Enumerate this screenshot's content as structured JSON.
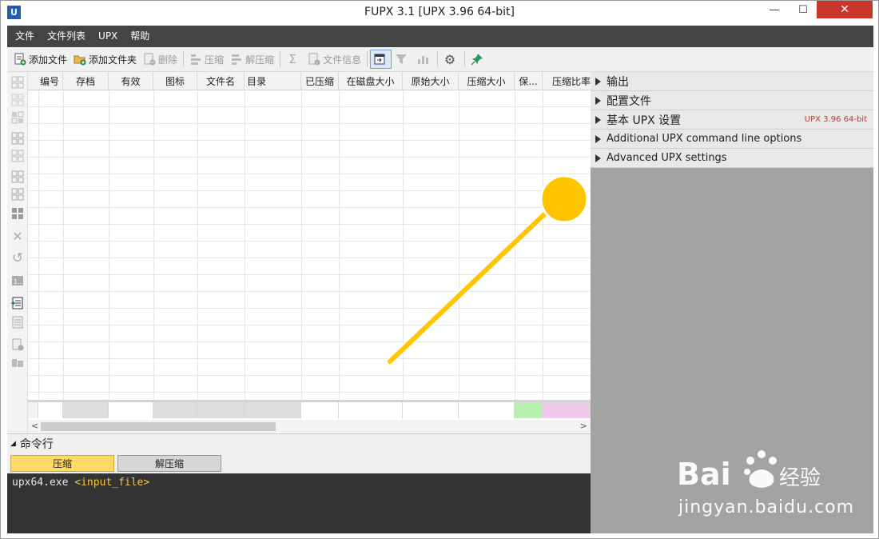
{
  "window": {
    "title": "FUPX 3.1   [UPX 3.96 64-bit]",
    "app_icon": "U",
    "min": "—",
    "max": "☐",
    "close": "✕"
  },
  "menu": [
    "文件",
    "文件列表",
    "UPX",
    "帮助"
  ],
  "toolbar": {
    "add_file": "添加文件",
    "add_folder": "添加文件夹",
    "delete": "删除",
    "compress": "压缩",
    "decompress": "解压缩",
    "file_info": "文件信息"
  },
  "grid": {
    "columns": [
      "编号",
      "存档",
      "有效",
      "图标",
      "文件名",
      "目录",
      "已压缩",
      "在磁盘大小",
      "原始大小",
      "压缩大小",
      "保...",
      "压缩比率"
    ],
    "scroll_left": "<",
    "scroll_right": ">"
  },
  "command": {
    "header": "命令行",
    "tab_compress": "压缩",
    "tab_decompress": "解压缩",
    "cmd_exe": "upx64.exe",
    "cmd_arg": "<input_file>"
  },
  "panel": {
    "sections": [
      {
        "label": "输出"
      },
      {
        "label": "配置文件"
      },
      {
        "label": "基本 UPX 设置",
        "tag": "UPX 3.96 64-bit"
      },
      {
        "label": "Additional UPX command line options"
      },
      {
        "label": "Advanced UPX settings"
      }
    ]
  },
  "colors": {
    "menubar": "#444444",
    "accent_yellow": "#ffc600",
    "active_tab": "#ffd966",
    "panel_bg": "#a3a3a3",
    "footer_green": "#b8f0b0",
    "footer_pink": "#f0c8ec"
  },
  "watermark": {
    "brand": "Bai du 经验",
    "url": "jingyan.baidu.com"
  }
}
